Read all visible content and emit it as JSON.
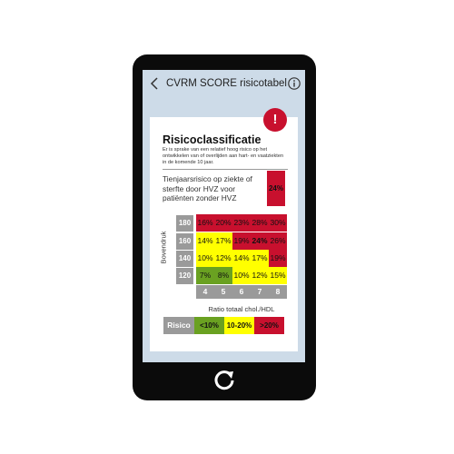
{
  "app": {
    "title": "CVRM SCORE risicotabel",
    "back_icon": "chevron-left-icon",
    "info_icon": "info-icon",
    "home_icon": "refresh-icon"
  },
  "card": {
    "alert_symbol": "!",
    "heading": "Risicoclassificatie",
    "description": "Er is sprake van een relatief hoog risico op het ontwikkelen van of overlijden aan hart- en vaatziekten in de komende 10 jaar.",
    "risk_label": "Tienjaarsrisico op ziekte of sterfte door HVZ voor patiënten zonder HVZ",
    "risk_value": "24%"
  },
  "table": {
    "y_axis_label": "Bovendruk",
    "x_axis_label": "Ratio totaal chol./HDL",
    "columns": [
      "4",
      "5",
      "6",
      "7",
      "8"
    ],
    "rows": [
      {
        "label": "180",
        "cells": [
          "16%",
          "20%",
          "23%",
          "28%",
          "30%"
        ],
        "colors": [
          "red",
          "red",
          "red",
          "red",
          "red"
        ]
      },
      {
        "label": "160",
        "cells": [
          "14%",
          "17%",
          "19%",
          "24%",
          "26%"
        ],
        "colors": [
          "yellow",
          "yellow",
          "red",
          "red",
          "red"
        ]
      },
      {
        "label": "140",
        "cells": [
          "10%",
          "12%",
          "14%",
          "17%",
          "19%"
        ],
        "colors": [
          "yellow",
          "yellow",
          "yellow",
          "yellow",
          "red"
        ]
      },
      {
        "label": "120",
        "cells": [
          "7%",
          "8%",
          "10%",
          "12%",
          "15%"
        ],
        "colors": [
          "green",
          "green",
          "yellow",
          "yellow",
          "yellow"
        ]
      }
    ],
    "highlight": {
      "row": 1,
      "col": 3
    }
  },
  "legend": {
    "title": "Risico",
    "items": [
      {
        "label": "<10%",
        "color": "green"
      },
      {
        "label": "10-20%",
        "color": "yellow"
      },
      {
        "label": ">20%",
        "color": "red"
      }
    ]
  },
  "colors": {
    "red": "#c8102e",
    "yellow": "#ffff00",
    "green": "#6aa121",
    "gray": "#9a9a9a",
    "screen_bg": "#cddbe8"
  }
}
